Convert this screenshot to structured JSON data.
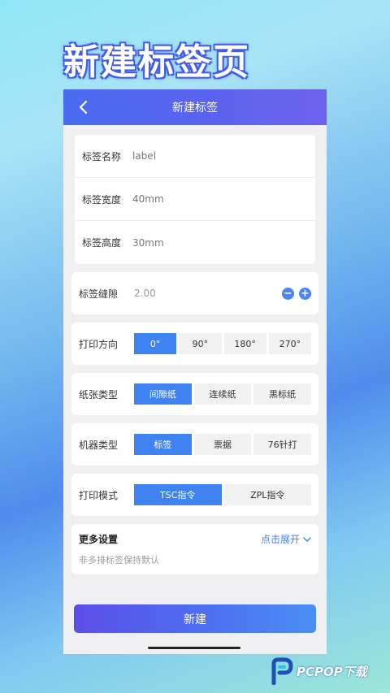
{
  "hero": {
    "title": "新建标签页"
  },
  "appbar": {
    "title": "新建标签"
  },
  "fields": [
    {
      "label": "标签名称",
      "placeholder": "label"
    },
    {
      "label": "标签宽度",
      "placeholder": "40mm"
    },
    {
      "label": "标签高度",
      "placeholder": "30mm"
    }
  ],
  "gap": {
    "label": "标签缝隙",
    "value": "2.00",
    "minus_symbol": "−",
    "plus_symbol": "+"
  },
  "direction": {
    "label": "打印方向",
    "options": [
      "0°",
      "90°",
      "180°",
      "270°"
    ],
    "selected": "0°"
  },
  "paper": {
    "label": "纸张类型",
    "options": [
      "间隙纸",
      "连续纸",
      "黑标纸"
    ],
    "selected": "间隙纸"
  },
  "machine": {
    "label": "机器类型",
    "options": [
      "标签",
      "票据",
      "76针打"
    ],
    "selected": "标签"
  },
  "mode": {
    "label": "打印模式",
    "options": [
      "TSC指令",
      "ZPL指令"
    ],
    "selected": "TSC指令"
  },
  "more": {
    "title": "更多设置",
    "expand": "点击展开",
    "subtitle": "非多排标签保持默认"
  },
  "create_button": "新建",
  "watermark": {
    "text": "PCPOP下载"
  },
  "colors": {
    "accent": "#3f82f2",
    "appbar": "#5b63ee",
    "background": "#f0f0f2"
  }
}
